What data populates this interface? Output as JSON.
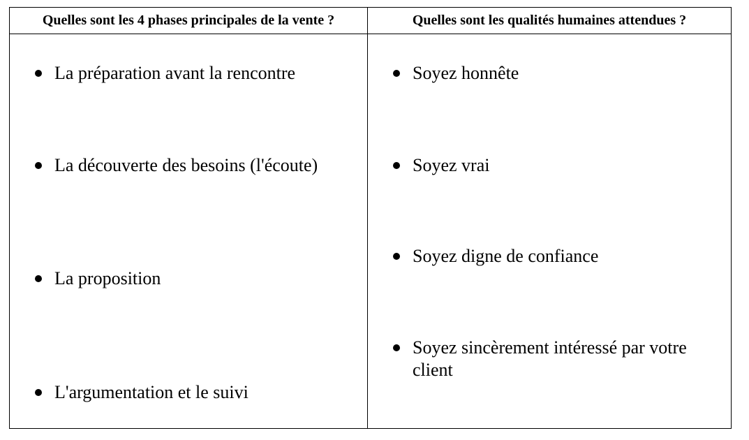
{
  "table": {
    "headers": [
      "Quelles sont les 4 phases principales de la vente ?",
      "Quelles sont les qualités humaines attendues ?"
    ],
    "left_items": [
      "La préparation avant la rencontre",
      "La découverte des besoins (l'écoute)",
      "La proposition",
      "L'argumentation et le suivi"
    ],
    "right_items": [
      "Soyez honnête",
      "Soyez vrai",
      "Soyez digne de confiance",
      "Soyez sincèrement intéressé par votre client"
    ]
  }
}
